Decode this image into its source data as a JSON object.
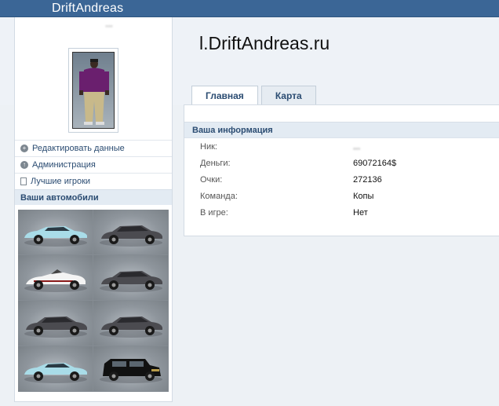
{
  "topbar": {
    "brand": "DriftAndreas"
  },
  "header": {
    "title": "l.DriftAndreas.ru"
  },
  "sidebar": {
    "username": "...",
    "menu": [
      {
        "label": "Редактировать данные",
        "icon": "plus-circle-icon"
      },
      {
        "label": "Администрация",
        "icon": "arrow-up-circle-icon"
      },
      {
        "label": "Лучшие игроки",
        "icon": "document-icon"
      }
    ],
    "cars_title": "Ваши автомобили",
    "cars": [
      {
        "color": "#a9dce8",
        "type": "sports-car-icon"
      },
      {
        "color": "#4b4b50",
        "type": "sedan-car-icon"
      },
      {
        "color": "#f4f4f4",
        "type": "roadster-car-icon"
      },
      {
        "color": "#4b4b50",
        "type": "sedan-car-icon"
      },
      {
        "color": "#4b4b50",
        "type": "sedan-car-icon"
      },
      {
        "color": "#4b4b50",
        "type": "sedan-car-icon"
      },
      {
        "color": "#a9dce8",
        "type": "sports-car-icon"
      },
      {
        "color": "#111111",
        "type": "suv-car-icon"
      }
    ]
  },
  "tabs": [
    {
      "label": "Главная",
      "active": true
    },
    {
      "label": "Карта",
      "active": false
    }
  ],
  "info": {
    "title": "Ваша информация",
    "rows": [
      {
        "label": "Ник:",
        "value": "..."
      },
      {
        "label": "Деньги:",
        "value": "69072164$"
      },
      {
        "label": "Очки:",
        "value": "272136"
      },
      {
        "label": "Команда:",
        "value": "Копы"
      },
      {
        "label": "В игре:",
        "value": "Нет"
      }
    ]
  }
}
